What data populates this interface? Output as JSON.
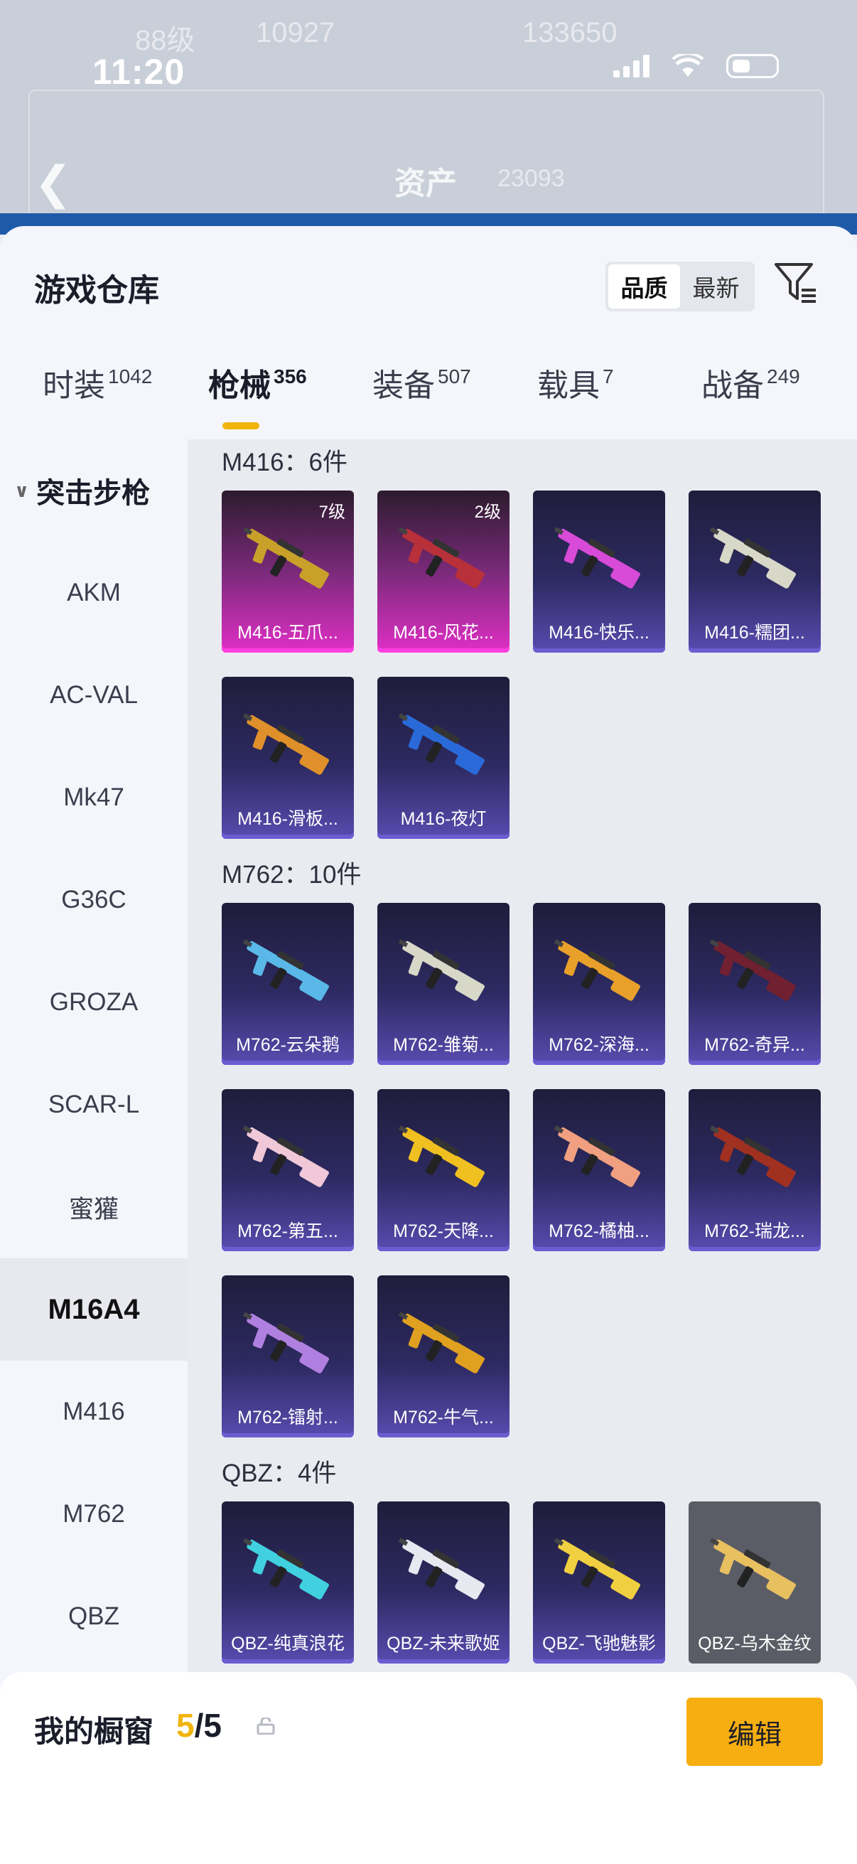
{
  "status_bar": {
    "time": "11:20"
  },
  "background": {
    "level_text": "88级",
    "score_left": "10927",
    "score_right": "133650",
    "asset_title": "资产",
    "asset_value": "23093"
  },
  "sheet": {
    "title": "游戏仓库",
    "sort_options": [
      "品质",
      "最新"
    ],
    "active_sort": "品质"
  },
  "tabs": [
    {
      "label": "时装",
      "count": "1042"
    },
    {
      "label": "枪械",
      "count": "356"
    },
    {
      "label": "装备",
      "count": "507"
    },
    {
      "label": "载具",
      "count": "7"
    },
    {
      "label": "战备",
      "count": "249"
    }
  ],
  "active_tab": "枪械",
  "categories": {
    "header": "突击步枪",
    "items": [
      "AKM",
      "AC-VAL",
      "Mk47",
      "G36C",
      "GROZA",
      "SCAR-L",
      "蜜獾",
      "M16A4",
      "M416",
      "M762",
      "QBZ"
    ],
    "active": "M16A4"
  },
  "sections": [
    {
      "title": "M416：6件",
      "items": [
        {
          "name": "M416-五爪...",
          "level": "7级",
          "rarity": "pink"
        },
        {
          "name": "M416-风花...",
          "level": "2级",
          "rarity": "pink"
        },
        {
          "name": "M416-快乐...",
          "level": "",
          "rarity": "purple"
        },
        {
          "name": "M416-糯团...",
          "level": "",
          "rarity": "purple"
        },
        {
          "name": "M416-滑板...",
          "level": "",
          "rarity": "purple"
        },
        {
          "name": "M416-夜灯",
          "level": "",
          "rarity": "purple"
        }
      ]
    },
    {
      "title": "M762：10件",
      "items": [
        {
          "name": "M762-云朵鹅",
          "level": "",
          "rarity": "purple"
        },
        {
          "name": "M762-雏菊...",
          "level": "",
          "rarity": "purple"
        },
        {
          "name": "M762-深海...",
          "level": "",
          "rarity": "purple"
        },
        {
          "name": "M762-奇异...",
          "level": "",
          "rarity": "purple"
        },
        {
          "name": "M762-第五...",
          "level": "",
          "rarity": "purple"
        },
        {
          "name": "M762-天降...",
          "level": "",
          "rarity": "purple"
        },
        {
          "name": "M762-橘柚...",
          "level": "",
          "rarity": "purple"
        },
        {
          "name": "M762-瑞龙...",
          "level": "",
          "rarity": "purple"
        },
        {
          "name": "M762-镭射...",
          "level": "",
          "rarity": "purple"
        },
        {
          "name": "M762-牛气...",
          "level": "",
          "rarity": "purple"
        }
      ]
    },
    {
      "title": "QBZ：4件",
      "items": [
        {
          "name": "QBZ-纯真浪花",
          "level": "",
          "rarity": "purple"
        },
        {
          "name": "QBZ-未来歌姬",
          "level": "",
          "rarity": "purple"
        },
        {
          "name": "QBZ-飞驰魅影",
          "level": "",
          "rarity": "purple"
        },
        {
          "name": "QBZ-乌木金纹",
          "level": "",
          "rarity": "gray"
        }
      ]
    }
  ],
  "showcase": {
    "label": "我的橱窗",
    "current": "5",
    "total": "/5",
    "edit_label": "编辑"
  },
  "colors": {
    "accent": "#f1b40d",
    "edit_button": "#f6ae10",
    "rarity_pink": "#e02fc6",
    "rarity_purple": "#5a4bb0"
  },
  "icons": [
    "back-icon",
    "filter-icon",
    "chevron-down-icon",
    "share-icon",
    "lock-icon"
  ]
}
